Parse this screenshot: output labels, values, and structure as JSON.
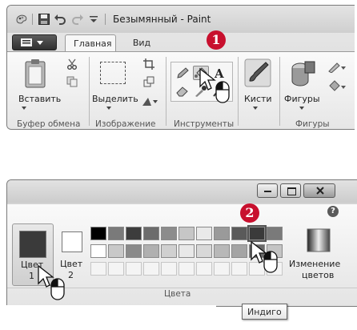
{
  "top_window": {
    "title": "Безымянный - Paint",
    "tabs": [
      {
        "label": "Главная",
        "selected": true
      },
      {
        "label": "Вид",
        "selected": false
      }
    ],
    "groups": {
      "clipboard": {
        "label": "Буфер обмена",
        "paste_label": "Вставить"
      },
      "image": {
        "label": "Изображение",
        "select_label": "Выделить"
      },
      "tools": {
        "label": "Инструменты"
      },
      "brushes": {
        "label": "Кисти"
      },
      "shapes": {
        "label": "Фигуры",
        "group_label": "Фигуры"
      }
    },
    "callout_number": "1"
  },
  "bottom_window": {
    "colors": {
      "color1_label": "Цвет",
      "color1_num": "1",
      "color2_label": "Цвет",
      "color2_num": "2",
      "group_label": "Цвета",
      "edit_colors_line1": "Изменение",
      "edit_colors_line2": "цветов",
      "color1_value": "#3a3a3a",
      "color2_value": "#ffffff"
    },
    "palette_row1": [
      "#000000",
      "#7a7a7a",
      "#3c3c3c",
      "#6c6c6c",
      "#8c8c8c",
      "#c6c6c6",
      "#e9e9e9",
      "#9a9a9a",
      "#5a5a5a",
      "#3a3a3a",
      "#7a7a7a"
    ],
    "palette_row2": [
      "#ffffff",
      "#c8c8c8",
      "#8a8a8a",
      "#b0b0b0",
      "#d0d0d0",
      "#e8e8e8",
      "#d8d8d8",
      "#b8b8b8",
      "#a4a4a4",
      "#6a6a6a",
      "#c4c4c4"
    ],
    "palette_row3_count": 11,
    "callout_number": "2",
    "tooltip": "Индиго"
  },
  "icons": {
    "quick_access": [
      "paint-app-icon",
      "save-icon",
      "undo-icon",
      "redo-icon",
      "customize-dropdown-icon"
    ],
    "window_buttons": [
      "minimize-icon",
      "maximize-icon",
      "close-icon"
    ],
    "help": "help-icon"
  },
  "colors": {
    "callout": "#c8102e",
    "ribbon_bg": "#f2f2f2",
    "frame": "#7a7a7a"
  }
}
